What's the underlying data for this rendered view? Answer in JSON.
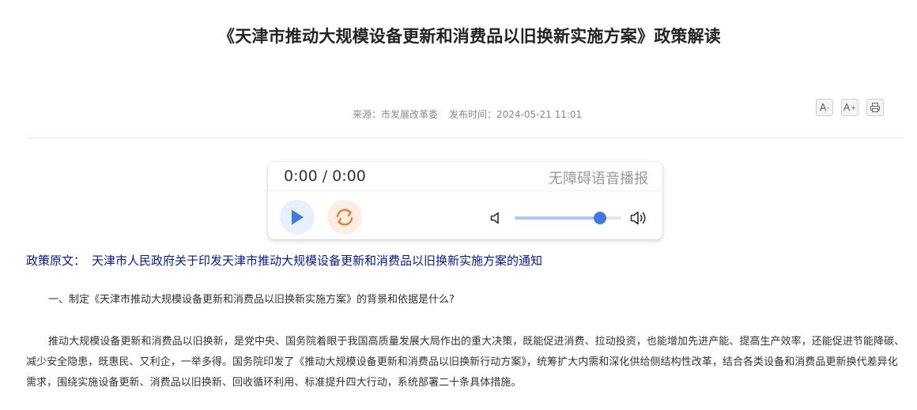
{
  "article": {
    "title": "《天津市推动大规模设备更新和消费品以旧换新实施方案》政策解读",
    "source_label": "来源：市发展改革委",
    "publish_label": "发布时间：2024-05-21 11:01"
  },
  "tools": {
    "font_decrease": "A",
    "font_decrease_mark": "-",
    "font_increase": "A",
    "font_increase_mark": "+",
    "print_icon": "printer-icon"
  },
  "player": {
    "time": "0:00 / 0:00",
    "label": "无障碍语音播报",
    "volume_percent": 80,
    "play_icon": "play-icon",
    "loop_icon": "loop-icon",
    "accent_color": "#3f79dd",
    "loop_color": "#f0782d"
  },
  "policy": {
    "prefix": "政策原文：",
    "link_text": "天津市人民政府关于印发天津市推动大规模设备更新和消费品以旧换新实施方案的通知",
    "link_color": "#0b1a8a"
  },
  "body": {
    "question_1": "一、制定《天津市推动大规模设备更新和消费品以旧换新实施方案》的背景和依据是什么?",
    "paragraph_1": "推动大规模设备更新和消费品以旧换新，是党中央、国务院着眼于我国高质量发展大局作出的重大决策，既能促进消费、拉动投资，也能增加先进产能、提高生产效率，还能促进节能降碳、减少安全隐患，既惠民、又利企，一举多得。国务院印发了《推动大规模设备更新和消费品以旧换新行动方案》，统筹扩大内需和深化供给侧结构性改革，结合各类设备和消费品更新换代差异化需求，围绕实施设备更新、消费品以旧换新、回收循环利用、标准提升四大行动，系统部署二十条具体措施。"
  }
}
